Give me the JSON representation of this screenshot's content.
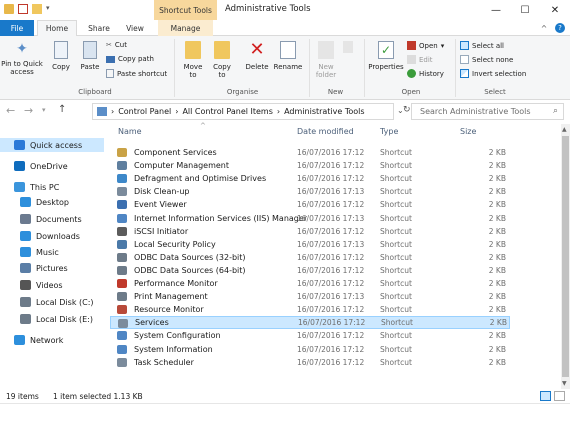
{
  "window": {
    "context_tab": "Shortcut Tools",
    "title": "Administrative Tools",
    "minimize": "—",
    "maximize": "☐",
    "close": "✕"
  },
  "tabs": {
    "file": "File",
    "home": "Home",
    "share": "Share",
    "view": "View",
    "manage": "Manage"
  },
  "ribbon": {
    "pin": "Pin to Quick access",
    "copy": "Copy",
    "paste": "Paste",
    "cut": "Cut",
    "copy_path": "Copy path",
    "paste_shortcut": "Paste shortcut",
    "clipboard": "Clipboard",
    "move_to": "Move to",
    "copy_to": "Copy to",
    "delete": "Delete",
    "rename": "Rename",
    "organise": "Organise",
    "new_folder": "New folder",
    "new": "New",
    "properties": "Properties",
    "open": "Open",
    "edit": "Edit",
    "history": "History",
    "open_group": "Open",
    "select_all": "Select all",
    "select_none": "Select none",
    "invert_selection": "Invert selection",
    "select": "Select"
  },
  "address": {
    "crumbs": [
      "Control Panel",
      "All Control Panel Items",
      "Administrative Tools"
    ],
    "search_placeholder": "Search Administrative Tools"
  },
  "nav": {
    "items": [
      {
        "label": "Quick access",
        "icon": "star-icon",
        "color": "#2b79d8"
      },
      {
        "label": "OneDrive",
        "icon": "cloud-icon",
        "color": "#0f6cbd"
      },
      {
        "label": "This PC",
        "icon": "computer-icon",
        "color": "#3b95dc"
      },
      {
        "label": "Desktop",
        "icon": "desktop-icon",
        "color": "#2d8fdc"
      },
      {
        "label": "Documents",
        "icon": "document-icon",
        "color": "#6b7a8f"
      },
      {
        "label": "Downloads",
        "icon": "download-icon",
        "color": "#2d8fdc"
      },
      {
        "label": "Music",
        "icon": "music-icon",
        "color": "#2d8fdc"
      },
      {
        "label": "Pictures",
        "icon": "pictures-icon",
        "color": "#5a7ea6"
      },
      {
        "label": "Videos",
        "icon": "video-icon",
        "color": "#555555"
      },
      {
        "label": "Local Disk (C:)",
        "icon": "drive-icon",
        "color": "#6d7b89"
      },
      {
        "label": "Local Disk (E:)",
        "icon": "drive-icon",
        "color": "#6d7b89"
      },
      {
        "label": "Network",
        "icon": "network-icon",
        "color": "#2d8fdc"
      }
    ]
  },
  "columns": {
    "name": "Name",
    "date": "Date modified",
    "type": "Type",
    "size": "Size"
  },
  "files": [
    {
      "name": "Component Services",
      "date": "16/07/2016 17:12",
      "type": "Shortcut",
      "size": "2 KB",
      "color": "#c9a246"
    },
    {
      "name": "Computer Management",
      "date": "16/07/2016 17:12",
      "type": "Shortcut",
      "size": "2 KB",
      "color": "#5f7f9f"
    },
    {
      "name": "Defragment and Optimise Drives",
      "date": "16/07/2016 17:12",
      "type": "Shortcut",
      "size": "2 KB",
      "color": "#3d88c9"
    },
    {
      "name": "Disk Clean-up",
      "date": "16/07/2016 17:13",
      "type": "Shortcut",
      "size": "2 KB",
      "color": "#7b8b9c"
    },
    {
      "name": "Event Viewer",
      "date": "16/07/2016 17:12",
      "type": "Shortcut",
      "size": "2 KB",
      "color": "#3b6fb0"
    },
    {
      "name": "Internet Information Services (IIS) Manager",
      "date": "16/07/2016 17:13",
      "type": "Shortcut",
      "size": "2 KB",
      "color": "#4f86c4"
    },
    {
      "name": "iSCSI Initiator",
      "date": "16/07/2016 17:12",
      "type": "Shortcut",
      "size": "2 KB",
      "color": "#5c5c5c"
    },
    {
      "name": "Local Security Policy",
      "date": "16/07/2016 17:13",
      "type": "Shortcut",
      "size": "2 KB",
      "color": "#4a79a8"
    },
    {
      "name": "ODBC Data Sources (32-bit)",
      "date": "16/07/2016 17:12",
      "type": "Shortcut",
      "size": "2 KB",
      "color": "#6d7b89"
    },
    {
      "name": "ODBC Data Sources (64-bit)",
      "date": "16/07/2016 17:12",
      "type": "Shortcut",
      "size": "2 KB",
      "color": "#6d7b89"
    },
    {
      "name": "Performance Monitor",
      "date": "16/07/2016 17:12",
      "type": "Shortcut",
      "size": "2 KB",
      "color": "#c0392b"
    },
    {
      "name": "Print Management",
      "date": "16/07/2016 17:13",
      "type": "Shortcut",
      "size": "2 KB",
      "color": "#6d7b89"
    },
    {
      "name": "Resource Monitor",
      "date": "16/07/2016 17:12",
      "type": "Shortcut",
      "size": "2 KB",
      "color": "#b84a3a"
    },
    {
      "name": "Services",
      "date": "16/07/2016 17:12",
      "type": "Shortcut",
      "size": "2 KB",
      "color": "#7b8b9c",
      "selected": true
    },
    {
      "name": "System Configuration",
      "date": "16/07/2016 17:12",
      "type": "Shortcut",
      "size": "2 KB",
      "color": "#4f86c4"
    },
    {
      "name": "System Information",
      "date": "16/07/2016 17:12",
      "type": "Shortcut",
      "size": "2 KB",
      "color": "#4f86c4"
    },
    {
      "name": "Task Scheduler",
      "date": "16/07/2016 17:12",
      "type": "Shortcut",
      "size": "2 KB",
      "color": "#7b8b9c"
    }
  ],
  "status": {
    "count": "19 items",
    "selection": "1 item selected  1.13 KB"
  },
  "colors": {
    "accent": "#1979ca",
    "selection": "#cce8ff",
    "context_tab": "#f7d79c"
  }
}
